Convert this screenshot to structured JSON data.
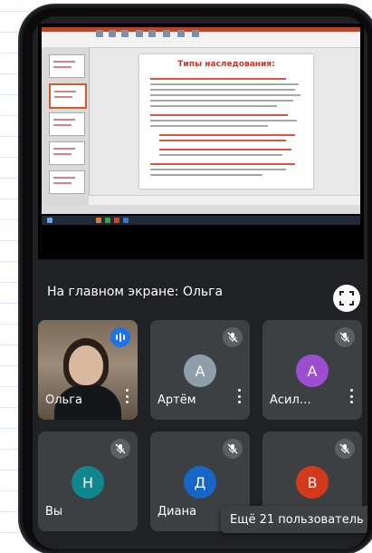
{
  "presentation": {
    "slide_title": "Типы наследования:"
  },
  "main_screen": {
    "label": "На главном экране: Ольга",
    "fullscreen_icon": "fullscreen-icon"
  },
  "participants": [
    {
      "name": "Ольга",
      "initial": "",
      "color": "",
      "status": "speaking",
      "has_video": true
    },
    {
      "name": "Артём",
      "initial": "А",
      "color": "#8f9eab",
      "status": "muted",
      "has_video": false
    },
    {
      "name": "Асил…",
      "initial": "А",
      "color": "#9c4dd0",
      "status": "muted",
      "has_video": false
    },
    {
      "name": "Вы",
      "initial": "Н",
      "color": "#11878d",
      "status": "muted",
      "has_video": false
    },
    {
      "name": "Диана",
      "initial": "Д",
      "color": "#1666c8",
      "status": "muted",
      "has_video": false
    },
    {
      "name": "",
      "initial": "В",
      "color": "#d23a1b",
      "status": "muted",
      "has_video": false
    }
  ],
  "more_participants": "Ещё 21 пользователь",
  "colors": {
    "background": "#202124",
    "tile": "#3c4043",
    "speaking": "#1a73e8",
    "slide_title": "#c0392b"
  }
}
